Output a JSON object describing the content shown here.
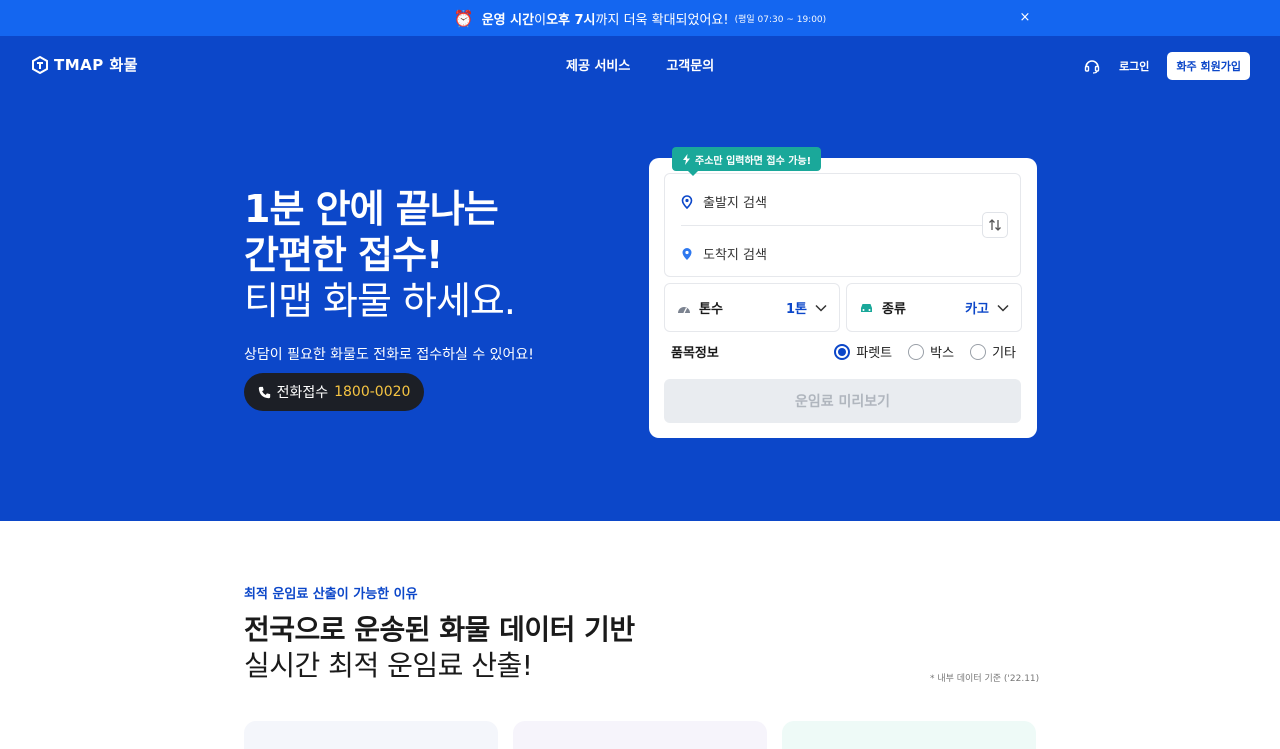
{
  "banner": {
    "icon": "alarm-clock-icon",
    "part1": "운영 시간",
    "part2": "이 ",
    "part3": "오후 7시",
    "part4": "까지 더욱 확대되었어요!",
    "small": "(평일 07:30 ~ 19:00)",
    "close": "×"
  },
  "header": {
    "logo_text": "TMAP 화물",
    "nav": [
      "제공 서비스",
      "고객문의"
    ],
    "login": "로그인",
    "signup": "화주 회원가입"
  },
  "hero": {
    "line1": "1분 안에 끝나는",
    "line2": "간편한 접수!",
    "line3": "티맵 화물 하세요.",
    "sub": "상담이 필요한 화물도 전화로 접수하실 수 있어요!",
    "call_label": "전화접수",
    "call_number": "1800-0020"
  },
  "card": {
    "tip": "주소만 입력하면 접수 가능!",
    "origin_placeholder": "출발지 검색",
    "dest_placeholder": "도착지 검색",
    "tonnage_label": "톤수",
    "tonnage_value": "1톤",
    "type_label": "종류",
    "type_value": "카고",
    "goods_title": "품목정보",
    "goods_options": [
      "파렛트",
      "박스",
      "기타"
    ],
    "goods_selected": "파렛트",
    "quote_button": "운임료 미리보기"
  },
  "section": {
    "eyebrow": "최적 운임료 산출이 가능한 이유",
    "title1": "전국으로 운송된 화물 데이터 기반",
    "title2": "실시간 최적 운임료 산출!",
    "note": "* 내부 데이터 기준 ('22.11)"
  },
  "colors": {
    "banner": "#1466f0",
    "hero": "#0c47c9",
    "accent_green": "#1aa89a",
    "call_number": "#f5c442",
    "primary": "#0c47c9"
  }
}
